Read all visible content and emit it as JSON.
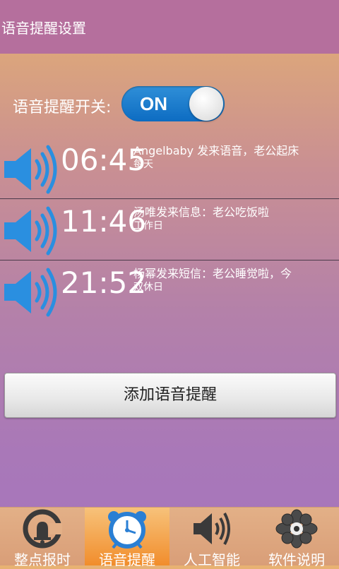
{
  "header": {
    "title": "语音提醒设置"
  },
  "voice_switch": {
    "label": "语音提醒开关:",
    "state": "ON"
  },
  "reminders": [
    {
      "time": "06:45",
      "message": "Angelbaby 发来语音，老公起床",
      "repeat": "每天"
    },
    {
      "time": "11:46",
      "message": "汤唯发来信息：老公吃饭啦",
      "repeat": "工作日"
    },
    {
      "time": "21:52",
      "message": "杨幂发来短信：老公睡觉啦，今",
      "repeat": "双休日"
    }
  ],
  "add_button": {
    "label": "添加语音提醒"
  },
  "tabs": [
    {
      "label": "整点报时",
      "icon": "bell-clock-icon",
      "active": false
    },
    {
      "label": "语音提醒",
      "icon": "alarm-clock-icon",
      "active": true
    },
    {
      "label": "人工智能",
      "icon": "speaker-icon",
      "active": false
    },
    {
      "label": "软件说明",
      "icon": "flower-icon",
      "active": false
    }
  ],
  "colors": {
    "titlebar": "#b56f9d",
    "toggle_on": "#1a78cc",
    "speaker": "#2a8fe0",
    "active_tab": "#f18d2c"
  }
}
